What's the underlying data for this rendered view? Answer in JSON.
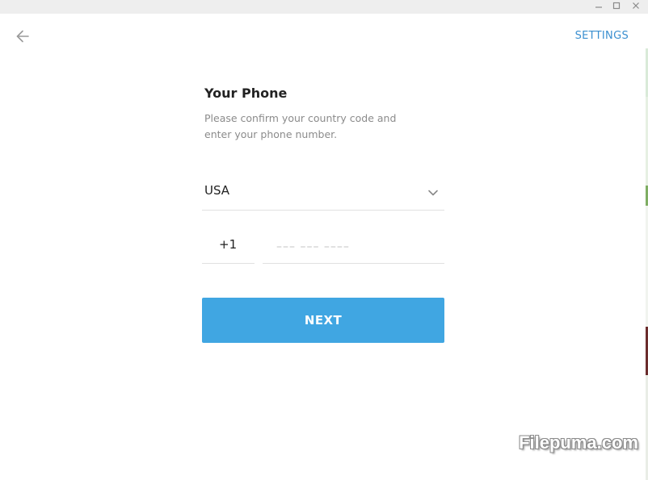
{
  "titlebar": {
    "minimize_icon": "minimize-icon",
    "maximize_icon": "maximize-icon",
    "close_icon": "close-icon"
  },
  "header": {
    "back_icon": "arrow-left-icon",
    "settings_label": "SETTINGS"
  },
  "form": {
    "title": "Your Phone",
    "description": "Please confirm your country code and enter your phone number.",
    "country": {
      "selected": "USA",
      "icon": "chevron-down-icon"
    },
    "country_code": "+1",
    "phone": {
      "value": "",
      "placeholder": "––– ––– ––––"
    },
    "next_label": "NEXT"
  },
  "watermark": "Filepuma.com",
  "colors": {
    "accent": "#40a6e2",
    "link": "#3a8fd0",
    "titlebar": "#eeeeee"
  }
}
